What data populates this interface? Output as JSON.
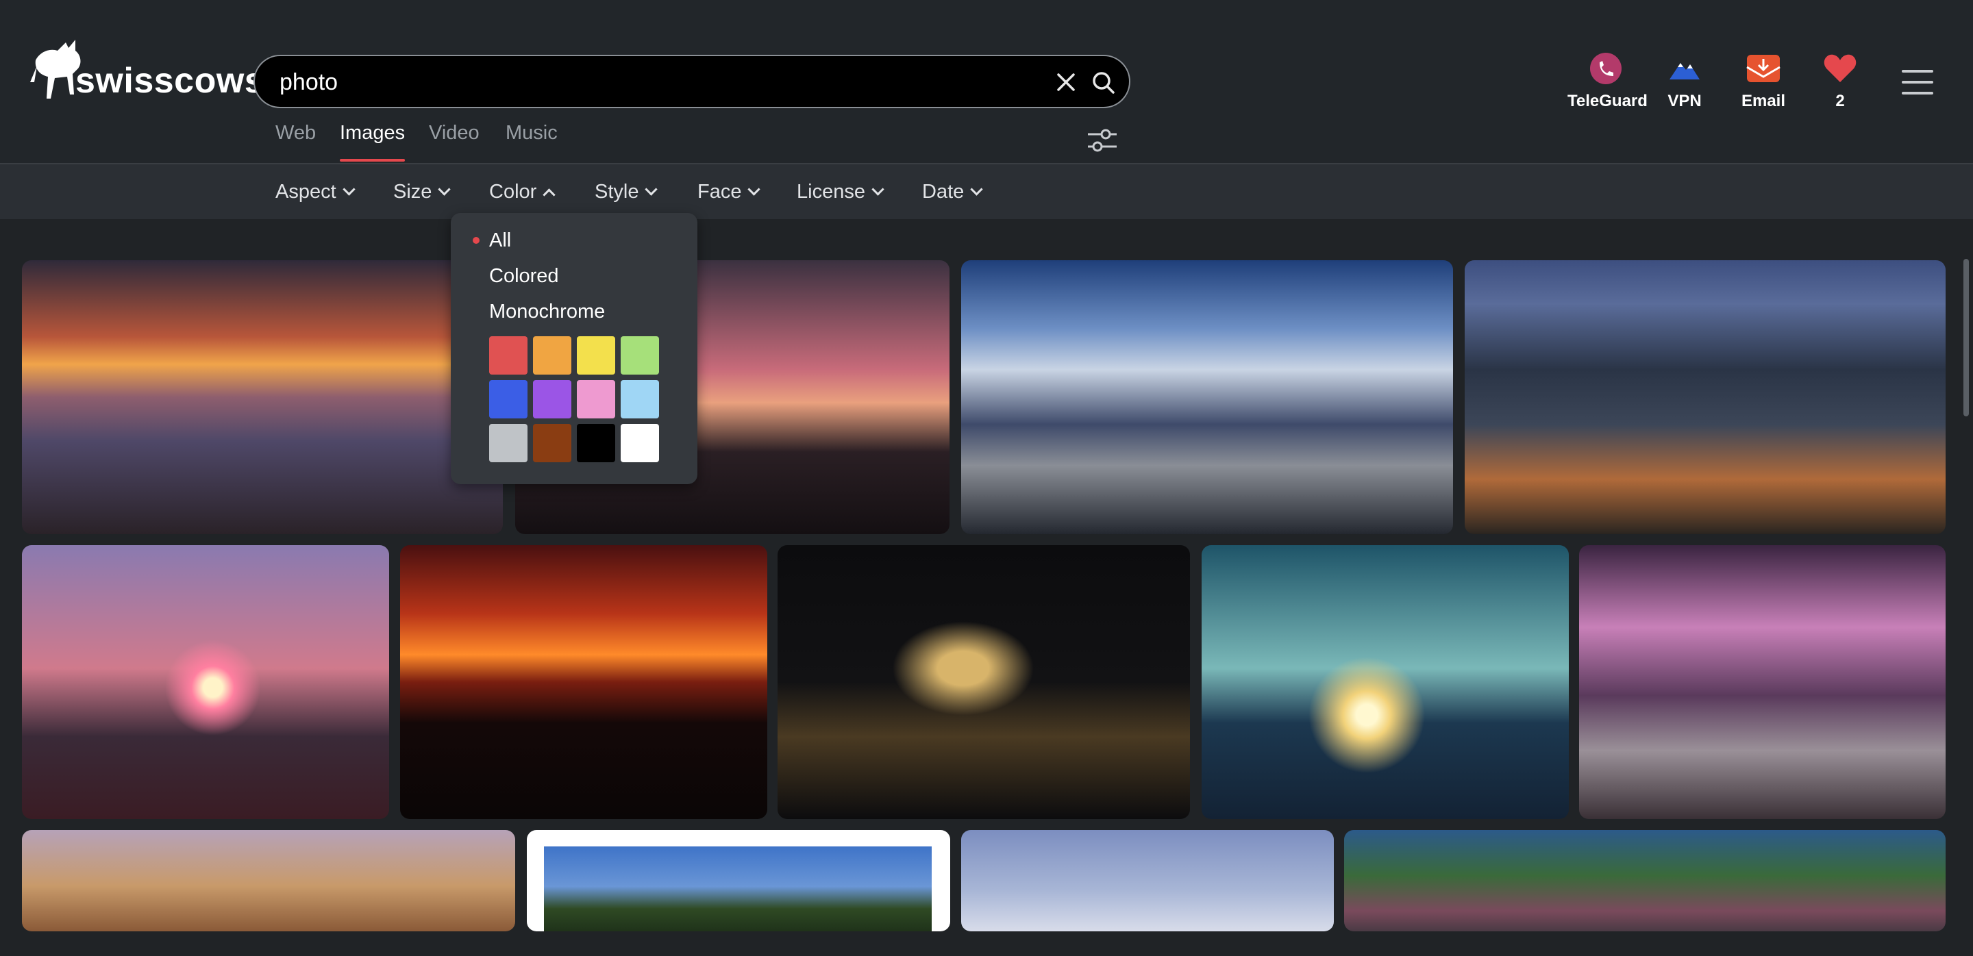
{
  "brand": {
    "name": "swisscows"
  },
  "search": {
    "query": "photo"
  },
  "tabs": [
    {
      "label": "Web"
    },
    {
      "label": "Images"
    },
    {
      "label": "Video"
    },
    {
      "label": "Music"
    }
  ],
  "active_tab": "Images",
  "quick_links": [
    {
      "label": "TeleGuard",
      "icon": "teleguard-icon"
    },
    {
      "label": "VPN",
      "icon": "vpn-icon"
    },
    {
      "label": "Email",
      "icon": "email-icon"
    },
    {
      "label": "2",
      "icon": "heart-icon"
    }
  ],
  "filters": [
    {
      "label": "Aspect"
    },
    {
      "label": "Size"
    },
    {
      "label": "Color"
    },
    {
      "label": "Style"
    },
    {
      "label": "Face"
    },
    {
      "label": "License"
    },
    {
      "label": "Date"
    }
  ],
  "color_dropdown": {
    "options": [
      "All",
      "Colored",
      "Monochrome"
    ],
    "selected": "All",
    "swatches": [
      "#e05252",
      "#f0a542",
      "#f3e04c",
      "#a6e07a",
      "#3b5ee6",
      "#9b55e6",
      "#ee9ad0",
      "#9fd6f5",
      "#bfc3c7",
      "#8a3d12",
      "#000000",
      "#ffffff"
    ]
  },
  "colors": {
    "accent": "#e5484d",
    "background": "#202326",
    "dropdown": "#34383d"
  }
}
